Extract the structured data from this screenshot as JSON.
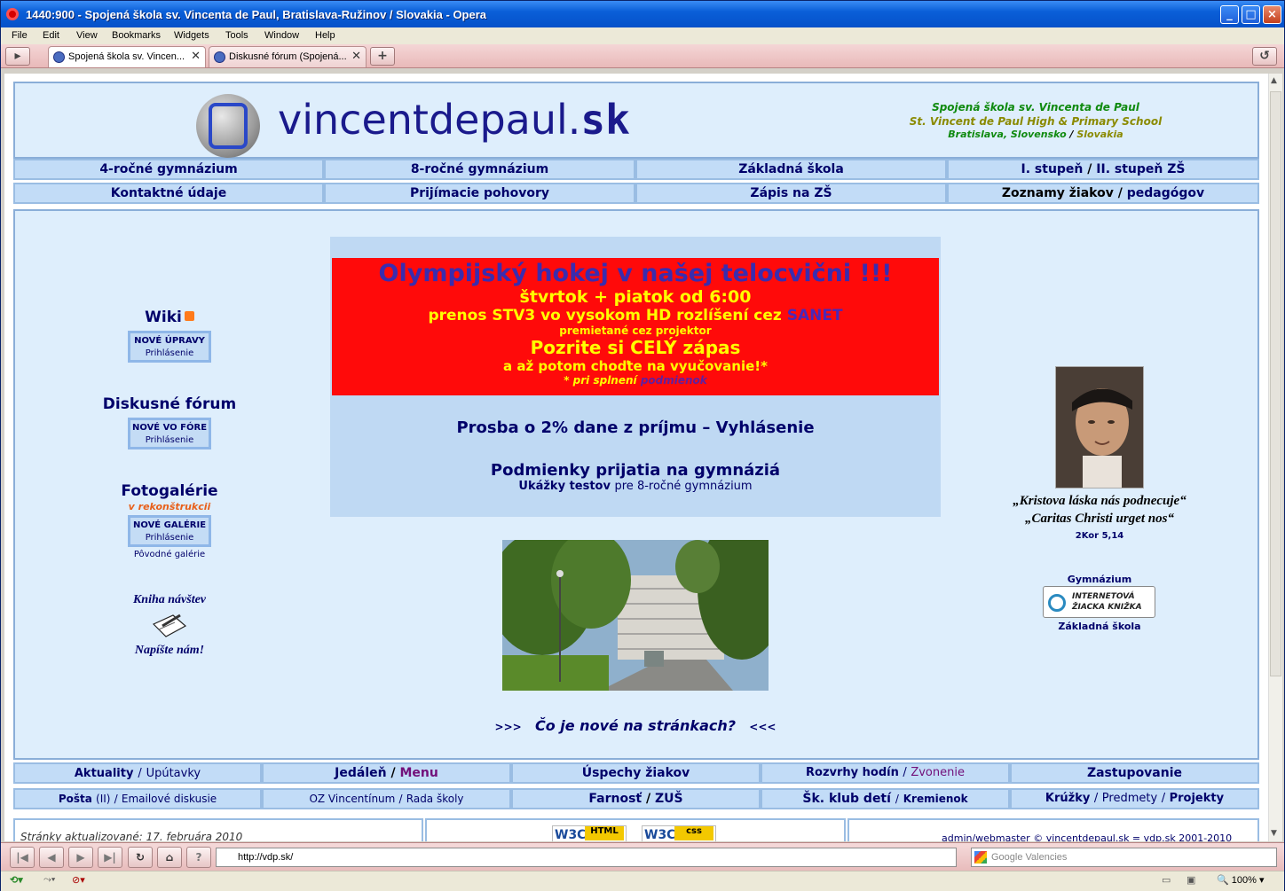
{
  "window": {
    "title": "1440:900 - Spojená škola sv. Vincenta de Paul, Bratislava-Ružinov / Slovakia - Opera"
  },
  "menu": [
    "File",
    "Edit",
    "View",
    "Bookmarks",
    "Widgets",
    "Tools",
    "Window",
    "Help"
  ],
  "tabs": [
    {
      "label": "Spojená škola sv. Vincen..."
    },
    {
      "label": "Diskusné fórum (Spojená..."
    }
  ],
  "header": {
    "logo_text": "vincentdepaul.",
    "logo_tld": "sk",
    "school_sk": "Spojená škola sv. Vincenta de Paul",
    "school_en": "St. Vincent de Paul High & Primary School",
    "city_sk": "Bratislava, Slovensko",
    "city_sep": "/",
    "city_en": "Slovakia"
  },
  "topnav": {
    "row1": [
      "4-ročné gymnázium",
      "8-ročné gymnázium",
      "Základná škola"
    ],
    "stupen1": "I. stupeň",
    "stupen2": "II. stupeň ZŠ",
    "row2": [
      "Kontaktné údaje",
      "Prijímacie pohovory",
      "Zápis na ZŠ"
    ],
    "zoznamy": "Zoznamy žiakov",
    "pedagogov": "pedagógov",
    "sep": "/"
  },
  "left": {
    "wiki_title": "Wiki",
    "wiki_btn": "NOVÉ ÚPRAVY",
    "wiki_login": "Prihlásenie",
    "forum_title": "Diskusné fórum",
    "forum_btn": "NOVÉ VO FÓRE",
    "forum_login": "Prihlásenie",
    "gallery_title": "Fotogalérie",
    "gallery_note": "v rekonštrukcii",
    "gallery_btn": "NOVÉ GALÉRIE",
    "gallery_login": "Prihlásenie",
    "gallery_old": "Pôvodné galérie",
    "guestbook": "Kniha návštev",
    "write_us": "Napíšte nám!"
  },
  "promo": {
    "headline": "Olympijský hokej v našej telocvični !!!",
    "line2": "štvrtok + piatok od 6:00",
    "line3": "prenos STV3 vo vysokom HD rozlíšení cez",
    "sanet": "SANET",
    "line4": "premietané cez projektor",
    "line5": "Pozrite si CELÝ zápas",
    "line6": "a až potom choďte na vyučovanie!*",
    "line7": "* pri splnení",
    "podmienok": "podmienok",
    "link1": "Prosba o 2% dane z príjmu – Vyhlásenie",
    "link2": "Podmienky prijatia na gymnáziá",
    "link3a": "Ukážky testov",
    "link3b": "pre 8-ročné gymnázium"
  },
  "whatsnew": {
    "arrows_left": ">>>",
    "text": "Čo je nové na stránkach?",
    "arrows_right": "<<<"
  },
  "right": {
    "quote1": "„Kristova láska nás podnecuje“",
    "quote2": "„Caritas Christi urget nos“",
    "ref": "2Kor 5,14",
    "gym": "Gymnázium",
    "ezk1": "INTERNETOVÁ",
    "ezk2": "ŽIACKA KNIŽKA",
    "zs": "Základná škola"
  },
  "bottomnav": {
    "aktuality": "Aktuality",
    "uputavky": "Upútavky",
    "jedalen": "Jedáleň",
    "menu": "Menu",
    "uspechy": "Úspechy žiakov",
    "rozvrhy": "Rozvrhy hodín",
    "zvonenie": "Zvonenie",
    "zastupovanie": "Zastupovanie",
    "posta": "Pošta",
    "posta_ii": "(II)",
    "emailove": "Emailové diskusie",
    "oz": "OZ Vincentínum",
    "rada": "Rada školy",
    "farnost": "Farnosť",
    "zus": "ZUŠ",
    "skd": "Šk. klub detí",
    "kremienok": "Kremienok",
    "kruzky": "Krúžky",
    "predmety": "Predmety",
    "projekty": "Projekty",
    "sep": "/"
  },
  "footer": {
    "updated": "Stránky aktualizované: 17. februára 2010",
    "w3c_html": "HTML",
    "w3c_css": "css",
    "w3c": "W3C",
    "admin": "admin/webmaster © vincentdepaul.sk = vdp.sk 2001-2010"
  },
  "addressbar": {
    "url": "http://vdp.sk/",
    "search_placeholder": "Google Valencies"
  },
  "statusbar": {
    "zoom": "100%"
  },
  "colors": {
    "page_bg": "#deeefc",
    "nav_cell": "#c2dcf7",
    "nav_text": "#00006a",
    "promo_red": "#ff0a0a",
    "promo_yellow": "#ffff00",
    "green": "#0f8a0f",
    "olive": "#8a8a00"
  }
}
